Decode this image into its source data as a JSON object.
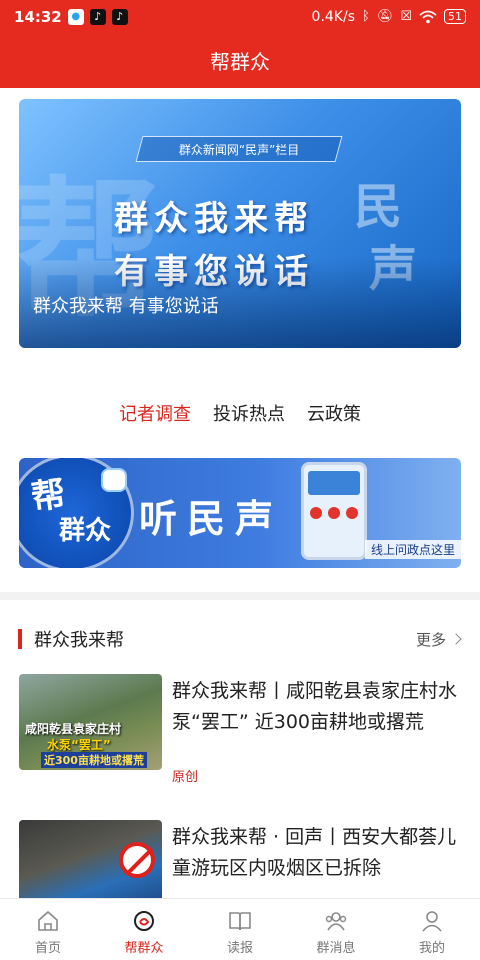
{
  "status_bar": {
    "time": "14:32",
    "net_speed": "0.4K/s",
    "battery": "51",
    "icons": [
      "wechat-icon",
      "tiktok-icon",
      "tiktok-icon",
      "bluetooth-icon",
      "mute-icon",
      "sim-off-icon",
      "wifi-icon",
      "battery-icon"
    ]
  },
  "header": {
    "title": "帮群众"
  },
  "hero": {
    "tag": "群众新闻网“民声”栏目",
    "line1": "群众我来帮",
    "line2": "有事您说话",
    "caption": "群众我来帮 有事您说话",
    "bg_chars": {
      "left": "帮",
      "right_top": "民",
      "right_bottom": "声"
    }
  },
  "tabs": [
    {
      "label": "记者调查",
      "active": true
    },
    {
      "label": "投诉热点",
      "active": false
    },
    {
      "label": "云政策",
      "active": false
    }
  ],
  "banner": {
    "badge_top": "帮",
    "badge_bottom": "群众",
    "headline": "听民声",
    "slogan": "线上问政点这里"
  },
  "section": {
    "title": "群众我来帮",
    "more": "更多"
  },
  "news": [
    {
      "title": "群众我来帮丨咸阳乾县袁家庄村水泵“罢工” 近300亩耕地或撂荒",
      "badge": "原创",
      "thumb_text": [
        "咸阳乾县袁家庄村",
        "水泵“罢工”",
        "近300亩耕地或撂荒"
      ]
    },
    {
      "title": "群众我来帮 · 回声丨西安大都荟儿童游玩区内吸烟区已拆除",
      "badge": ""
    }
  ],
  "tabbar": [
    {
      "label": "首页",
      "icon": "home-icon",
      "active": false
    },
    {
      "label": "帮群众",
      "icon": "help-icon",
      "active": true
    },
    {
      "label": "读报",
      "icon": "book-icon",
      "active": false
    },
    {
      "label": "群消息",
      "icon": "group-icon",
      "active": false
    },
    {
      "label": "我的",
      "icon": "user-icon",
      "active": false
    }
  ],
  "colors": {
    "brand_red": "#e52a1f",
    "active_red": "#d9271f",
    "text": "#222222",
    "muted": "#777777"
  }
}
